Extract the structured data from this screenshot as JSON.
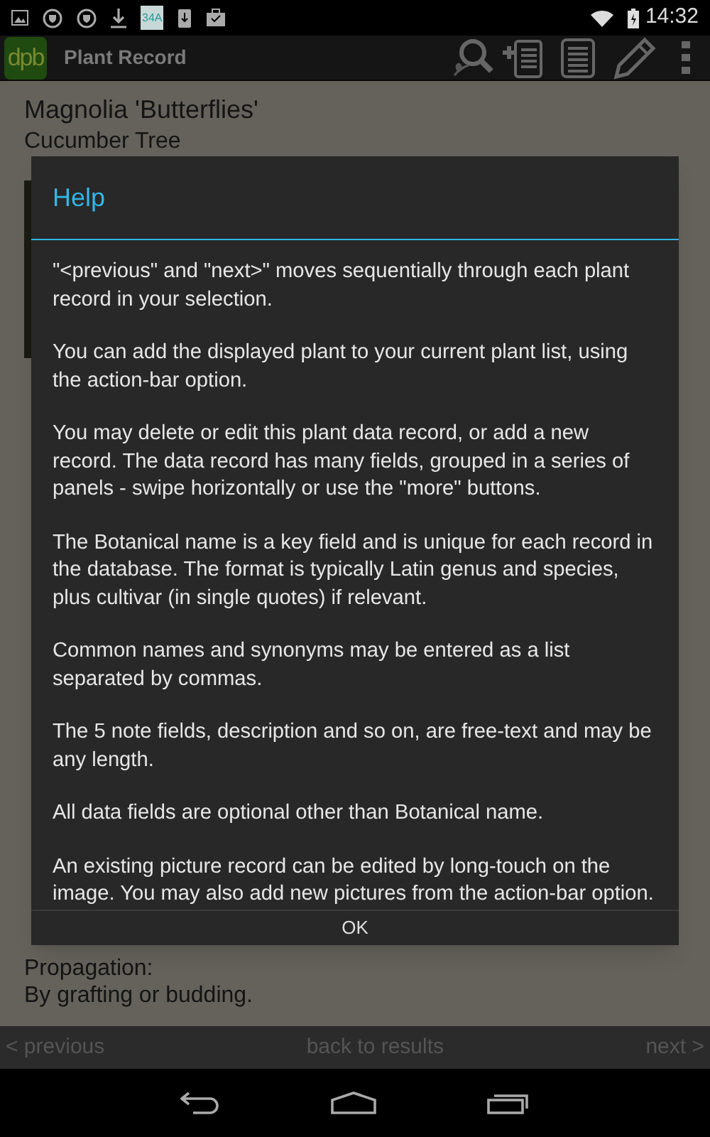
{
  "status_bar": {
    "time": "14:32",
    "notification_badge": "34A"
  },
  "action_bar": {
    "logo": "dpb",
    "title": "Plant Record"
  },
  "record": {
    "botanical_name": "Magnolia 'Butterflies'",
    "common_name": "Cucumber Tree",
    "propagation_label": "Propagation:",
    "propagation_value": "By grafting or budding."
  },
  "dialog": {
    "title": "Help",
    "paragraphs": [
      "\"<previous\" and \"next>\" moves sequentially through each plant record in your selection.",
      "You can add the displayed plant to your current plant list, using the action-bar option.",
      "You may delete or edit this plant data record, or add a new record.  The data record has many fields, grouped in a series of panels - swipe horizontally or use the \"more\" buttons.",
      "The Botanical name is a key field and is unique for each record in the database. The format is typically Latin genus and species, plus cultivar (in single quotes) if relevant.",
      "Common names and synonyms may be entered as a list separated by commas.",
      "The 5 note fields, description and so on,  are free-text and may be any length.",
      "All data fields are optional other than Botanical name.",
      "An existing picture record can be edited by long-touch on the image.  You may also add new pictures from the action-bar option."
    ],
    "button": "OK"
  },
  "bottom_bar": {
    "previous": "< previous",
    "back": "back to results",
    "next": "next >"
  }
}
